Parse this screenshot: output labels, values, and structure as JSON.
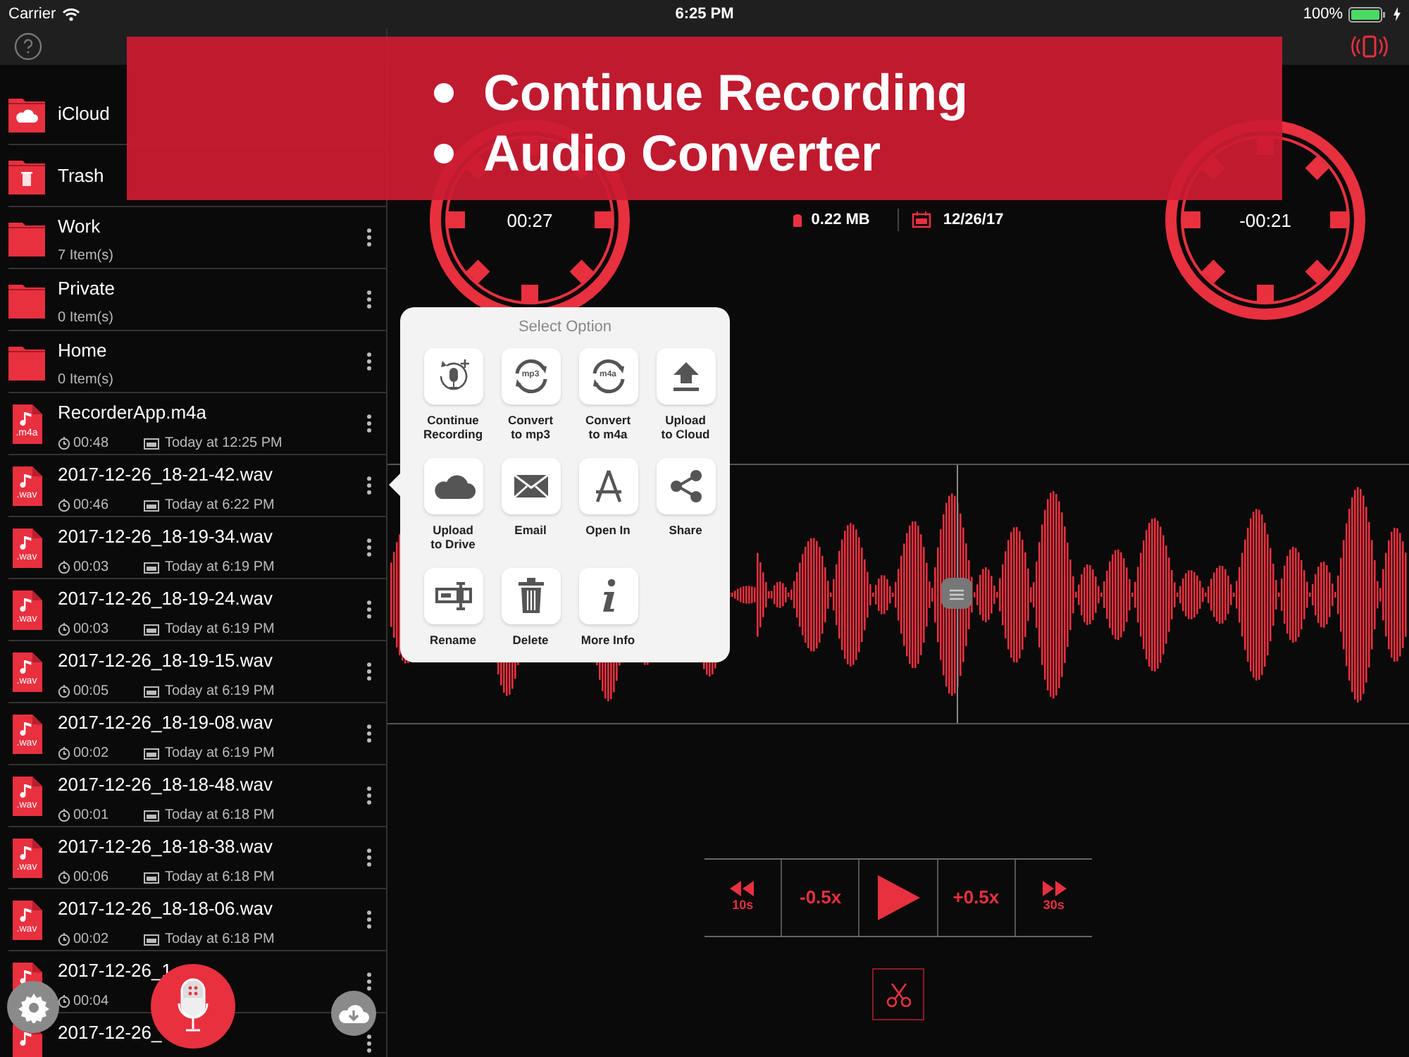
{
  "status_bar": {
    "carrier": "Carrier",
    "time": "6:25 PM",
    "battery": "100%"
  },
  "sidebar": {
    "items": [
      {
        "kind": "cloud_folder",
        "name": "iCloud"
      },
      {
        "kind": "trash_folder",
        "name": "Trash"
      },
      {
        "kind": "folder",
        "name": "Work",
        "count": "7 Item(s)"
      },
      {
        "kind": "folder",
        "name": "Private",
        "count": "0 Item(s)"
      },
      {
        "kind": "folder",
        "name": "Home",
        "count": "0 Item(s)"
      },
      {
        "kind": "file",
        "name": "RecorderApp.m4a",
        "ext": ".m4a",
        "duration": "00:48",
        "date": "Today at 12:25 PM"
      },
      {
        "kind": "file",
        "name": "2017-12-26_18-21-42.wav",
        "ext": ".wav",
        "duration": "00:46",
        "date": "Today at 6:22 PM"
      },
      {
        "kind": "file",
        "name": "2017-12-26_18-19-34.wav",
        "ext": ".wav",
        "duration": "00:03",
        "date": "Today at 6:19 PM"
      },
      {
        "kind": "file",
        "name": "2017-12-26_18-19-24.wav",
        "ext": ".wav",
        "duration": "00:03",
        "date": "Today at 6:19 PM"
      },
      {
        "kind": "file",
        "name": "2017-12-26_18-19-15.wav",
        "ext": ".wav",
        "duration": "00:05",
        "date": "Today at 6:19 PM"
      },
      {
        "kind": "file",
        "name": "2017-12-26_18-19-08.wav",
        "ext": ".wav",
        "duration": "00:02",
        "date": "Today at 6:19 PM"
      },
      {
        "kind": "file",
        "name": "2017-12-26_18-18-48.wav",
        "ext": ".wav",
        "duration": "00:01",
        "date": "Today at 6:18 PM"
      },
      {
        "kind": "file",
        "name": "2017-12-26_18-18-38.wav",
        "ext": ".wav",
        "duration": "00:06",
        "date": "Today at 6:18 PM"
      },
      {
        "kind": "file",
        "name": "2017-12-26_18-18-06.wav",
        "ext": ".wav",
        "duration": "00:02",
        "date": "Today at 6:18 PM"
      },
      {
        "kind": "file",
        "name": "2017-12-26_1",
        "duration": "00:04"
      },
      {
        "kind": "file",
        "name": "2017-12-26_"
      }
    ]
  },
  "playback": {
    "elapsed": "00:27",
    "remaining": "-00:21",
    "size": "0.22 MB",
    "date": "12/26/17",
    "playhead": {
      "level": 0.557
    },
    "controls": [
      {
        "kind": "rewind",
        "label": "10s"
      },
      {
        "kind": "text",
        "label": "-0.5x"
      },
      {
        "kind": "play"
      },
      {
        "kind": "text",
        "label": "+0.5x"
      },
      {
        "kind": "forward",
        "label": "30s"
      }
    ]
  },
  "popover": {
    "title": "Select Option",
    "options": [
      {
        "kind": "continue",
        "label": "Continue\nRecording"
      },
      {
        "kind": "convert",
        "icon_text": "mp3",
        "label": "Convert\nto mp3"
      },
      {
        "kind": "convert",
        "icon_text": "m4a",
        "label": "Convert\nto m4a"
      },
      {
        "kind": "upload",
        "label": "Upload\nto Cloud"
      },
      {
        "kind": "cloud",
        "label": "Upload\nto Drive"
      },
      {
        "kind": "email",
        "label": "Email"
      },
      {
        "kind": "open_in",
        "label": "Open In"
      },
      {
        "kind": "share",
        "label": "Share"
      },
      {
        "kind": "rename",
        "label": "Rename"
      },
      {
        "kind": "delete",
        "label": "Delete"
      },
      {
        "kind": "info",
        "label": "More Info"
      }
    ]
  },
  "banner": {
    "bullets": [
      "Continue Recording",
      "Audio Converter"
    ]
  }
}
